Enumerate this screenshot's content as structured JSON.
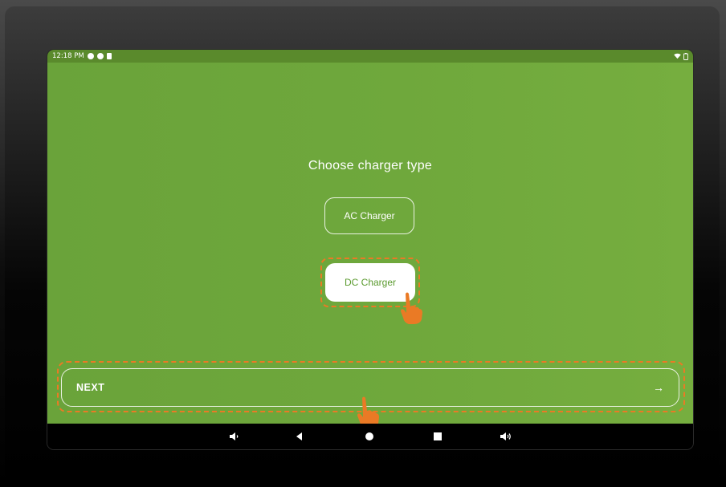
{
  "status_bar": {
    "time": "12:18 PM",
    "wifi_icon": "wifi-icon",
    "battery_icon": "battery-icon"
  },
  "screen": {
    "title": "Choose charger type",
    "options": [
      {
        "label": "AC Charger",
        "selected": false
      },
      {
        "label": "DC Charger",
        "selected": true
      }
    ],
    "next": {
      "label": "NEXT",
      "arrow": "→"
    }
  },
  "nav_bar": {
    "volume_down": "volume-down-icon",
    "back": "back-icon",
    "home": "home-icon",
    "recents": "recents-icon",
    "volume_up": "volume-up-icon"
  },
  "colors": {
    "app_green": "#6fa83c",
    "status_green": "#5a8a2c",
    "highlight_orange": "#ea7a25",
    "selected_text": "#5a9a2e"
  }
}
